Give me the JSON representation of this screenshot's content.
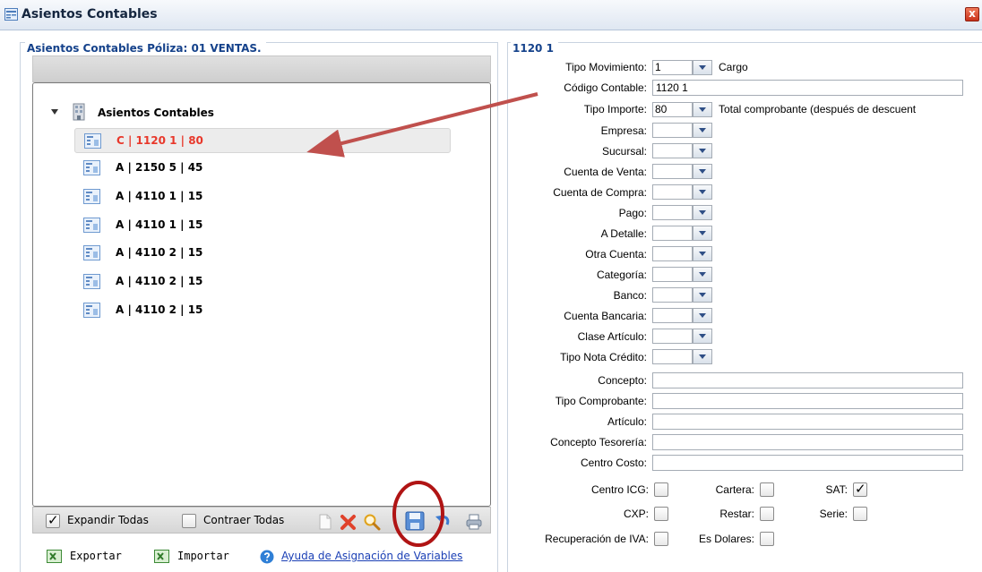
{
  "window": {
    "title": "Asientos Contables",
    "close_icon": "close-icon",
    "close_glyph": "x"
  },
  "left_panel": {
    "legend": "Asientos Contables Póliza: 01 VENTAS.",
    "tree": {
      "root_label": "Asientos Contables",
      "items": [
        {
          "label": "C | 1120 1 | 80",
          "selected": true
        },
        {
          "label": "A | 2150 5 | 45",
          "selected": false
        },
        {
          "label": "A | 4110 1 | 15",
          "selected": false
        },
        {
          "label": "A | 4110 1 | 15",
          "selected": false
        },
        {
          "label": "A | 4110 2 | 15",
          "selected": false
        },
        {
          "label": "A | 4110 2 | 15",
          "selected": false
        },
        {
          "label": "A | 4110 2 | 15",
          "selected": false
        }
      ]
    },
    "bottom_bar": {
      "expand_all_label": "Expandir Todas",
      "expand_all_checked": true,
      "collapse_all_label": "Contraer Todas",
      "collapse_all_checked": false,
      "toolbar_icons": [
        "new-icon",
        "delete-icon",
        "search-icon",
        "save-icon",
        "undo-icon",
        "print-icon"
      ]
    },
    "links": {
      "export_label": "Exportar",
      "import_label": "Importar",
      "help_label": "Ayuda de Asignación de Variables"
    }
  },
  "right_panel": {
    "legend": "1120 1",
    "fields": {
      "tipo_movimiento": {
        "label": "Tipo Movimiento:",
        "value": "1",
        "description": "Cargo"
      },
      "codigo_contable": {
        "label": "Código Contable:",
        "value": "1120 1"
      },
      "tipo_importe": {
        "label": "Tipo Importe:",
        "value": "80",
        "description": "Total comprobante (después de descuent"
      },
      "empresa": {
        "label": "Empresa:",
        "value": ""
      },
      "sucursal": {
        "label": "Sucursal:",
        "value": ""
      },
      "cuenta_venta": {
        "label": "Cuenta de Venta:",
        "value": ""
      },
      "cuenta_compra": {
        "label": "Cuenta de Compra:",
        "value": ""
      },
      "pago": {
        "label": "Pago:",
        "value": ""
      },
      "a_detalle": {
        "label": "A Detalle:",
        "value": ""
      },
      "otra_cuenta": {
        "label": "Otra Cuenta:",
        "value": ""
      },
      "categoria": {
        "label": "Categoría:",
        "value": ""
      },
      "banco": {
        "label": "Banco:",
        "value": ""
      },
      "cuenta_bancaria": {
        "label": "Cuenta Bancaria:",
        "value": ""
      },
      "clase_articulo": {
        "label": "Clase Artículo:",
        "value": ""
      },
      "tipo_nota_credito": {
        "label": "Tipo Nota Crédito:",
        "value": ""
      },
      "concepto": {
        "label": "Concepto:",
        "value": ""
      },
      "tipo_comprobante": {
        "label": "Tipo Comprobante:",
        "value": ""
      },
      "articulo": {
        "label": "Artículo:",
        "value": ""
      },
      "concepto_tesoreria": {
        "label": "Concepto Tesorería:",
        "value": ""
      },
      "centro_costo": {
        "label": "Centro Costo:",
        "value": ""
      }
    },
    "checkboxes": {
      "centro_icg": {
        "label": "Centro ICG:",
        "checked": false
      },
      "cartera": {
        "label": "Cartera:",
        "checked": false
      },
      "sat": {
        "label": "SAT:",
        "checked": true
      },
      "cxp": {
        "label": "CXP:",
        "checked": false
      },
      "restar": {
        "label": "Restar:",
        "checked": false
      },
      "serie": {
        "label": "Serie:",
        "checked": false
      },
      "recuperacion_iva": {
        "label": "Recuperación de IVA:",
        "checked": false
      },
      "es_dolares": {
        "label": "Es Dolares:",
        "checked": false
      }
    }
  },
  "annotations": {
    "arrow_color": "#c0504d",
    "circle_color": "#b01414"
  },
  "glyphs": {
    "check": "✓"
  }
}
